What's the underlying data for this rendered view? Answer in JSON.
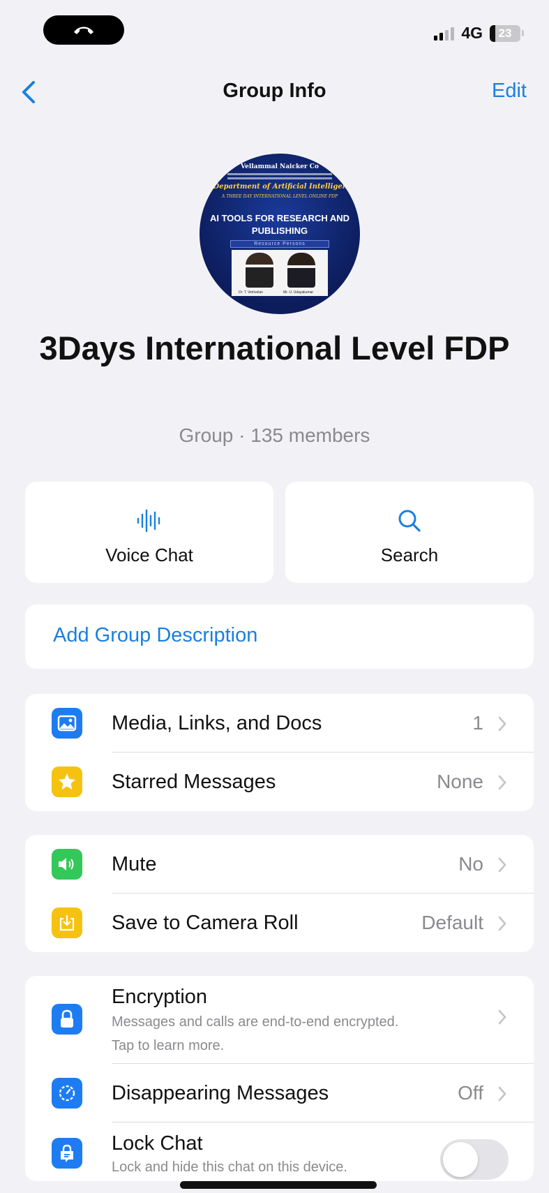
{
  "status_bar": {
    "network": "4G",
    "battery": "23"
  },
  "nav": {
    "title": "Group Info",
    "edit_label": "Edit"
  },
  "avatar_poster": {
    "line1": "Vellammal Naicker Co",
    "department": "Department of Artificial Intelligence",
    "event_line": "A THREE DAY INTERNATIONAL LEVEL ONLINE FDP",
    "headline_1": "AI TOOLS FOR RESEARCH AND",
    "headline_2": "PUBLISHING",
    "resource": "Resource Persons",
    "person_1": "Dr. T. Vetrivelan",
    "person_2": "Mr. U. Udayakumar"
  },
  "group": {
    "name": "3Days International Level FDP",
    "subtitle": "Group · 135 members"
  },
  "actions": [
    {
      "label": "Voice Chat",
      "icon": "voice-waveform-icon"
    },
    {
      "label": "Search",
      "icon": "search-icon"
    }
  ],
  "description": {
    "label": "Add Group Description"
  },
  "media_section": [
    {
      "title": "Media, Links, and Docs",
      "value": "1",
      "icon": "photo-icon",
      "color": "#1e7cf2"
    },
    {
      "title": "Starred Messages",
      "value": "None",
      "icon": "star-icon",
      "color": "#f5c211"
    }
  ],
  "settings_section": [
    {
      "title": "Mute",
      "value": "No",
      "icon": "speaker-icon",
      "color": "#34c759"
    },
    {
      "title": "Save to Camera Roll",
      "value": "Default",
      "icon": "save-download-icon",
      "color": "#f5c211"
    }
  ],
  "privacy_section": {
    "encryption": {
      "title": "Encryption",
      "sub1": "Messages and calls are end-to-end encrypted.",
      "sub2": "Tap to learn more.",
      "icon": "lock-icon",
      "color": "#1e7cf2"
    },
    "disappearing": {
      "title": "Disappearing Messages",
      "value": "Off",
      "icon": "timer-icon",
      "color": "#1e7cf2"
    },
    "lock_chat": {
      "title": "Lock Chat",
      "sub": "Lock and hide this chat on this device.",
      "enabled": false,
      "icon": "chat-lock-icon",
      "color": "#1e7cf2"
    }
  }
}
